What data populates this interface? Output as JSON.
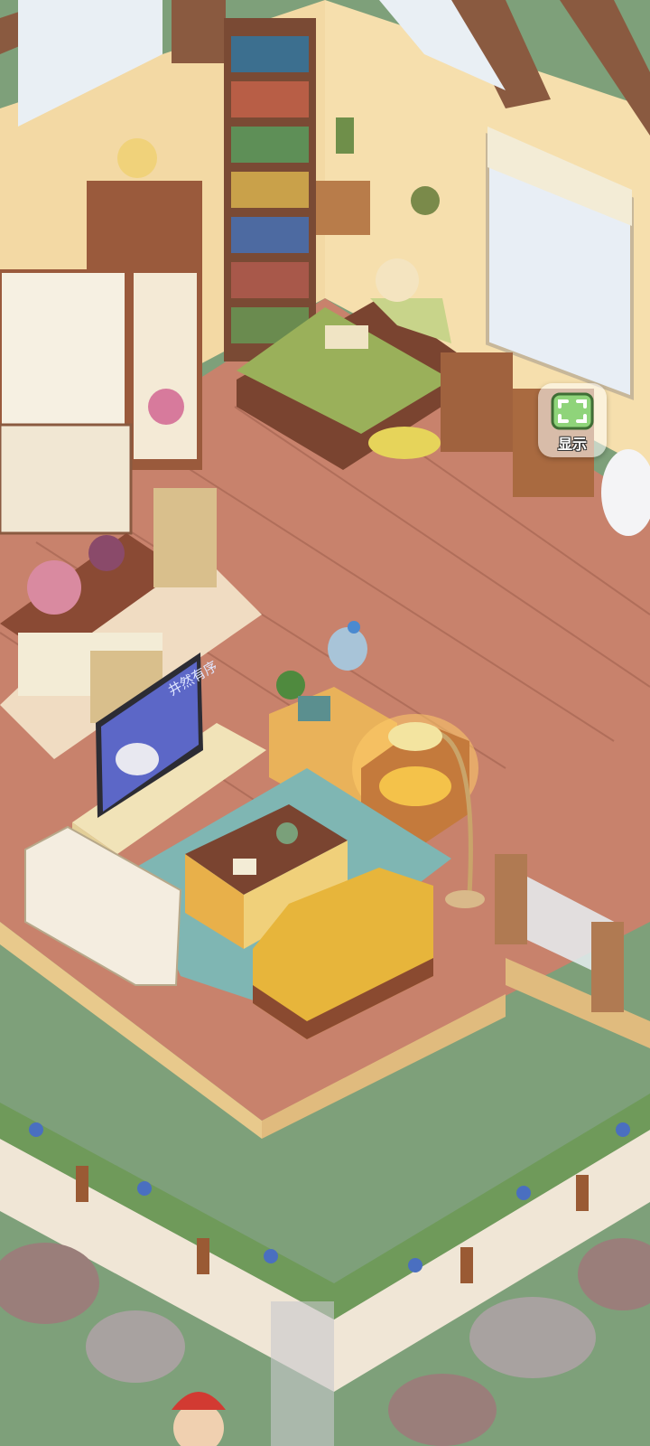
{
  "hud": {
    "show_button": {
      "label": "显示",
      "icon": "expand-corners-icon",
      "color": "#8fd47a"
    }
  },
  "scene": {
    "tv_screen_text": "井然有序",
    "colors": {
      "floor": "#c8826c",
      "wall": "#f3d9a4",
      "grass": "#7ea07a",
      "bed": "#9ab05a",
      "sofa": "#e7b53b",
      "rug": "#7fb6b3"
    }
  }
}
